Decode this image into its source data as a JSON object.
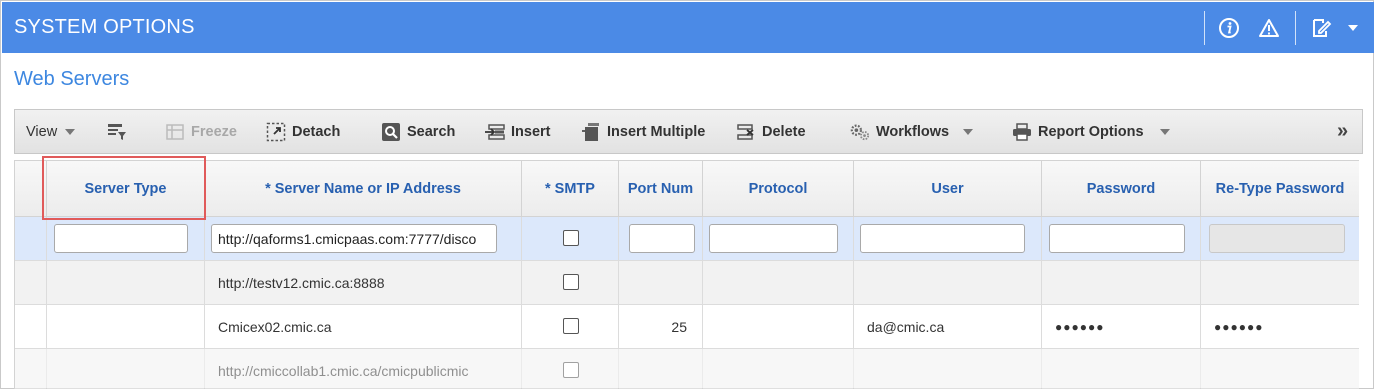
{
  "window": {
    "title": "SYSTEM OPTIONS",
    "icons": [
      "info-icon",
      "warning-icon",
      "edit-notes-icon",
      "dropdown-caret-icon"
    ],
    "bar_color": "#4b8ae6"
  },
  "section": {
    "title": "Web Servers"
  },
  "toolbar": {
    "view_label": "View",
    "freeze_label": "Freeze",
    "detach_label": "Detach",
    "search_label": "Search",
    "insert_label": "Insert",
    "insert_multiple_label": "Insert Multiple",
    "delete_label": "Delete",
    "workflows_label": "Workflows",
    "report_options_label": "Report Options",
    "overflow_glyph": "»"
  },
  "grid": {
    "columns": [
      "Server Type",
      "* Server Name or IP Address",
      "* SMTP",
      "Port Num",
      "Protocol",
      "User",
      "Password",
      "Re-Type Password"
    ],
    "rows": [
      {
        "server_type": "",
        "server_name": "http://qaforms1.cmicpaas.com:7777/disco",
        "smtp": false,
        "port": "",
        "protocol": "",
        "user": "",
        "password": "",
        "retype_password": "",
        "state": "editing"
      },
      {
        "server_type": "",
        "server_name": "http://testv12.cmic.ca:8888",
        "smtp": false,
        "port": "",
        "protocol": "",
        "user": "",
        "password": "",
        "retype_password": ""
      },
      {
        "server_type": "",
        "server_name": "Cmicex02.cmic.ca",
        "smtp": false,
        "port": "25",
        "protocol": "",
        "user": "da@cmic.ca",
        "password": "●●●●●●",
        "retype_password": "●●●●●●"
      },
      {
        "server_type": "",
        "server_name": "http://cmiccollab1.cmic.ca/cmicpublicmic",
        "smtp": false,
        "port": "",
        "protocol": "",
        "user": "",
        "password": "",
        "retype_password": ""
      }
    ]
  },
  "colors": {
    "accent": "#3d87e0",
    "header_text": "#2860b0",
    "selected_row": "#dce8fb",
    "highlight": "#e05a5a"
  }
}
